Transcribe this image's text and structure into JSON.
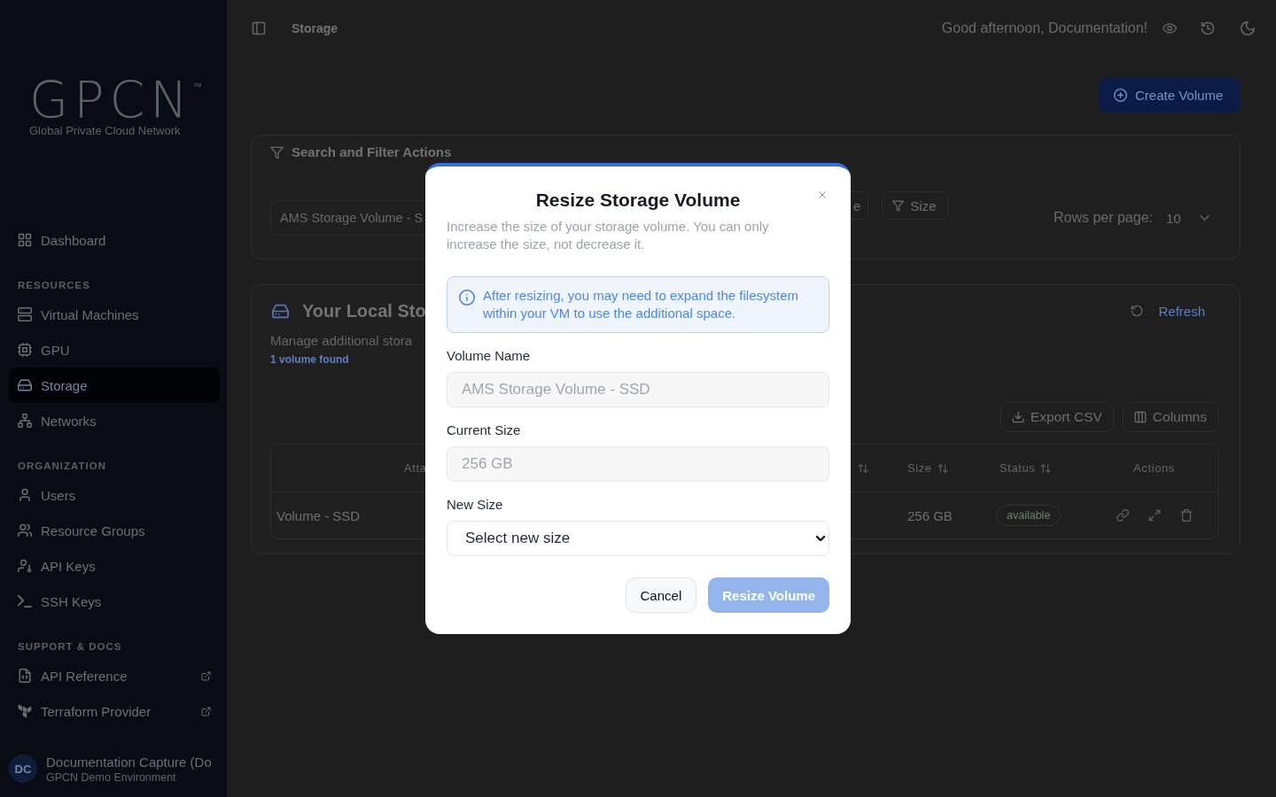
{
  "sidebar": {
    "logo": {
      "wordmark": "GPCN",
      "trademark": "™",
      "tagline": "Global Private Cloud Network"
    },
    "sections": [
      {
        "items": [
          {
            "label": "Dashboard",
            "selected": false,
            "external": false
          }
        ]
      },
      {
        "title": "RESOURCES",
        "items": [
          {
            "label": "Virtual Machines",
            "selected": false,
            "external": false
          },
          {
            "label": "GPU",
            "selected": false,
            "external": false
          },
          {
            "label": "Storage",
            "selected": true,
            "external": false
          },
          {
            "label": "Networks",
            "selected": false,
            "external": false
          }
        ]
      },
      {
        "title": "ORGANIZATION",
        "items": [
          {
            "label": "Users",
            "selected": false,
            "external": false
          },
          {
            "label": "Resource Groups",
            "selected": false,
            "external": false
          },
          {
            "label": "API Keys",
            "selected": false,
            "external": false
          },
          {
            "label": "SSH Keys",
            "selected": false,
            "external": false
          }
        ]
      },
      {
        "title": "SUPPORT & DOCS",
        "items": [
          {
            "label": "API Reference",
            "selected": false,
            "external": true
          },
          {
            "label": "Terraform Provider",
            "selected": false,
            "external": true
          }
        ]
      }
    ],
    "user": {
      "initials": "DC",
      "name": "Documentation Capture (Do",
      "subtitle": "GPCN Demo Environment"
    }
  },
  "topbar": {
    "title": "Storage",
    "greeting": "Good afternoon, Documentation!"
  },
  "create_button": "Create Volume",
  "filter_card": {
    "title": "Search and Filter Actions",
    "search": {
      "value": "AMS Storage Volume - S"
    },
    "filters": [
      {
        "kind": "plain",
        "label": "e"
      },
      {
        "kind": "filter",
        "label": "Size"
      }
    ],
    "rows_per_page": {
      "label": "Rows per page:",
      "value": "10"
    }
  },
  "storage_card": {
    "title": "Your Local Sto",
    "subtitle": "Manage additional stora",
    "count": "1 volume found",
    "refresh": "Refresh",
    "tools": [
      "Export CSV",
      "Columns"
    ],
    "table": {
      "columns": [
        {
          "label": "Atta",
          "sortable": false
        },
        {
          "sortable": true
        },
        {
          "label": "Size",
          "sortable": true
        },
        {
          "label": "Status",
          "sortable": true
        },
        {
          "label": "Actions",
          "sortable": false
        }
      ],
      "rows": [
        {
          "name": "Volume - SSD",
          "size": "256 GB",
          "status": "available"
        }
      ]
    }
  },
  "dialog": {
    "title": "Resize Storage Volume",
    "description": "Increase the size of your storage volume. You can only increase the size, not decrease it.",
    "notice": "After resizing, you may need to expand the filesystem within your VM to use the additional space.",
    "fields": [
      {
        "kind": "text",
        "label": "Volume Name",
        "value": "AMS Storage Volume - SSD",
        "disabled": true
      },
      {
        "kind": "text",
        "label": "Current Size",
        "value": "256 GB",
        "disabled": true
      },
      {
        "kind": "select",
        "label": "New Size",
        "value": "Select new size",
        "disabled": false
      }
    ],
    "buttons": [
      {
        "kind": "secondary",
        "label": "Cancel",
        "disabled": false
      },
      {
        "kind": "primary",
        "label": "Resize Volume",
        "disabled": true
      }
    ]
  }
}
